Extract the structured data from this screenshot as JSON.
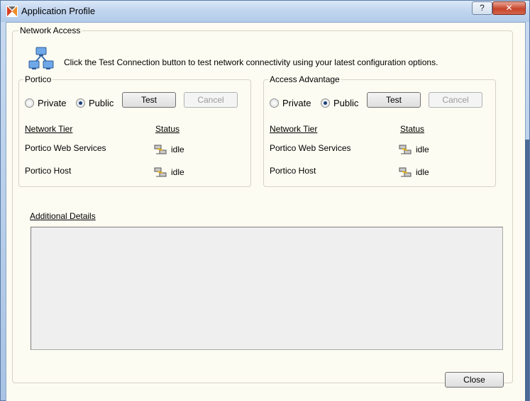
{
  "window": {
    "title": "Application Profile",
    "help_label": "?",
    "close_label": "✕"
  },
  "network_access": {
    "legend": "Network Access",
    "description": "Click the Test Connection button to test network connectivity using your latest configuration options.",
    "icon": "network-icon"
  },
  "portico": {
    "legend": "Portico",
    "private_label": "Private",
    "public_label": "Public",
    "selected": "Public",
    "test_label": "Test",
    "cancel_label": "Cancel",
    "col_tier": "Network Tier",
    "col_status": "Status",
    "rows": [
      {
        "tier": "Portico Web Services",
        "status": "idle"
      },
      {
        "tier": "Portico Host",
        "status": "idle"
      }
    ]
  },
  "access_advantage": {
    "legend": "Access Advantage",
    "private_label": "Private",
    "public_label": "Public",
    "selected": "Public",
    "test_label": "Test",
    "cancel_label": "Cancel",
    "col_tier": "Network Tier",
    "col_status": "Status",
    "rows": [
      {
        "tier": "Portico Web Services",
        "status": "idle"
      },
      {
        "tier": "Portico Host",
        "status": "idle"
      }
    ]
  },
  "details": {
    "label": "Additional Details",
    "content": ""
  },
  "footer": {
    "close_label": "Close"
  }
}
